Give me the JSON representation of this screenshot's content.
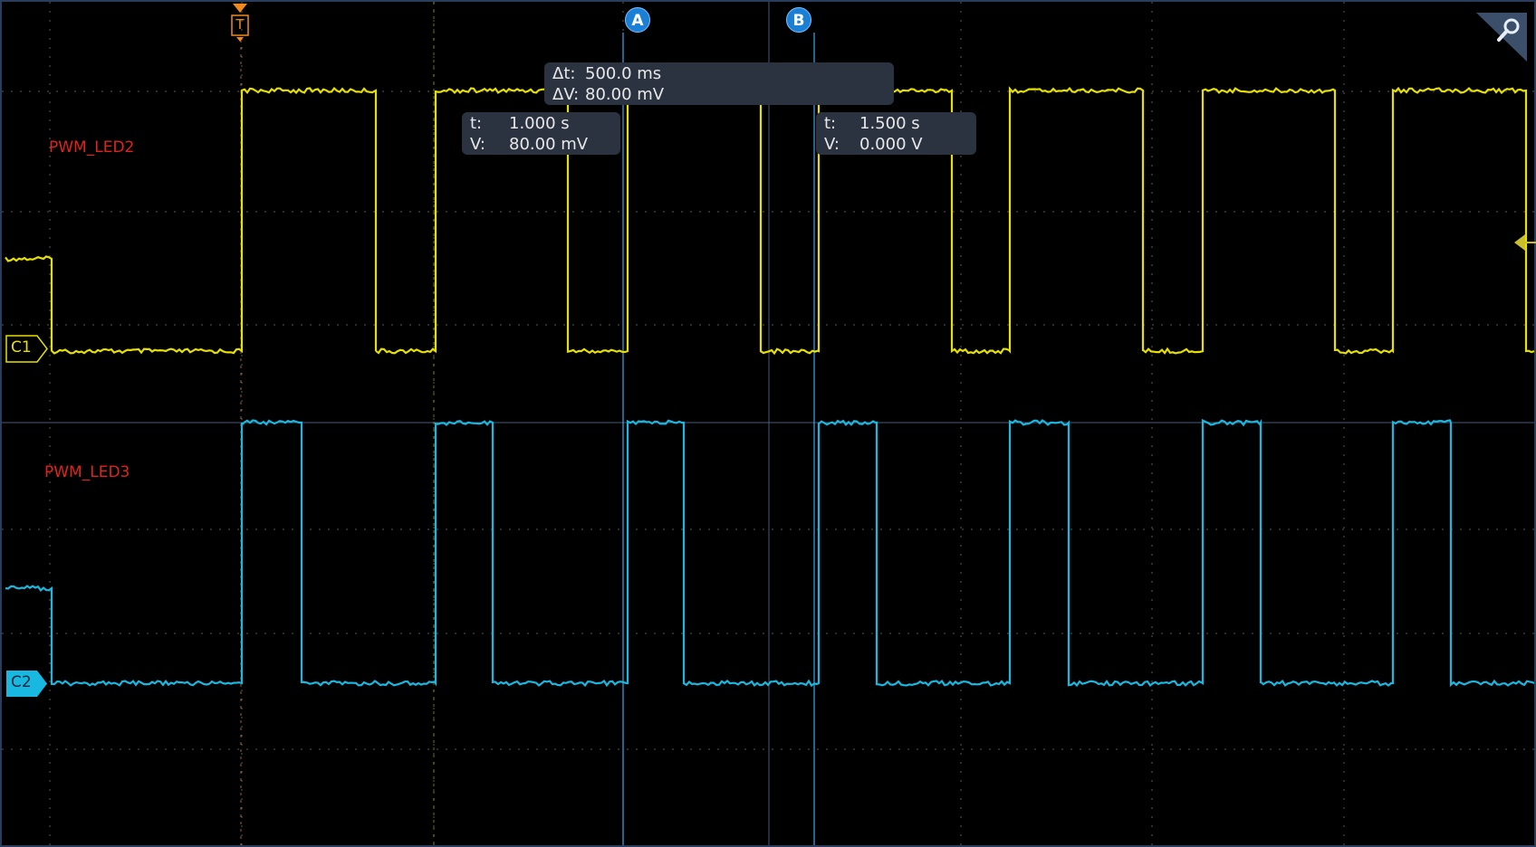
{
  "colors": {
    "background": "#000000",
    "grid": "#5a5a5a",
    "channel1": "#e6e000",
    "channel2": "#19b8e0",
    "cursor": "#3aa8e8",
    "trigger": "#f08a1e",
    "label": "#e0241b",
    "readout_bg": "#2c3340"
  },
  "channels": [
    {
      "id": "C1",
      "name": "PWM_LED2",
      "icon": "channel-1-marker"
    },
    {
      "id": "C2",
      "name": "PWM_LED3",
      "icon": "channel-2-marker"
    }
  ],
  "trigger": {
    "label": "T",
    "icon": "trigger-marker"
  },
  "cursors": {
    "a": {
      "label": "A",
      "t": "1.000 s",
      "v": "80.00 mV"
    },
    "b": {
      "label": "B",
      "t": "1.500 s",
      "v": "0.000 V"
    },
    "delta": {
      "dt": "500.0 ms",
      "dv": "80.00 mV"
    }
  },
  "readout_keys": {
    "t": "t:",
    "v": "V:",
    "dt": "Δt:",
    "dv": "ΔV:"
  },
  "zoom_icon": "magnifier-icon",
  "offset_icon": "offset-arrow-icon"
}
